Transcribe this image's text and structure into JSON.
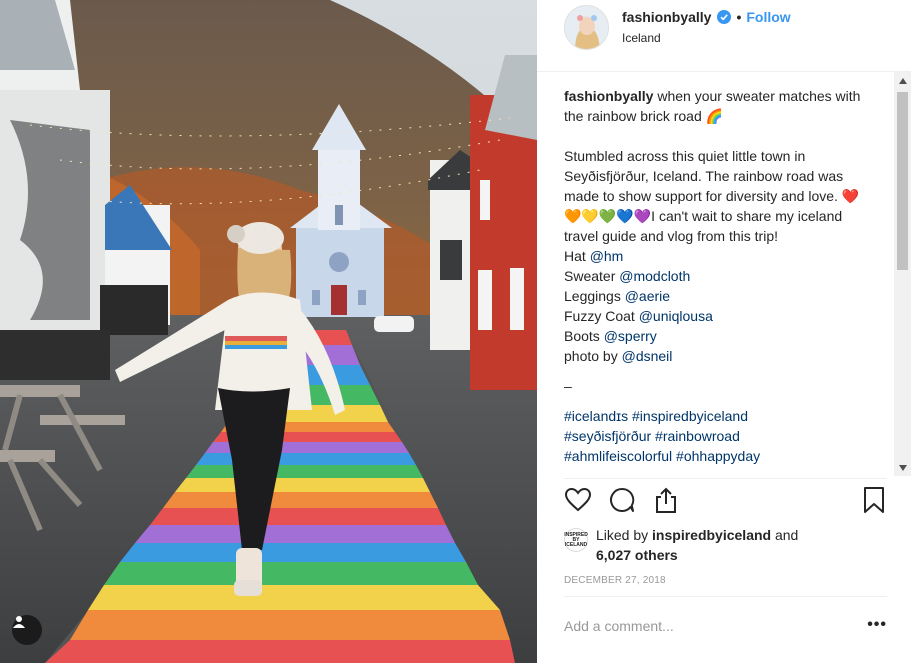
{
  "post": {
    "username": "fashionbyally",
    "follow_label": "Follow",
    "separator": "•",
    "location": "Iceland"
  },
  "caption": {
    "username": "fashionbyally",
    "line1": " when your sweater matches with the rainbow brick road 🌈",
    "para2": "Stumbled across this quiet little town in Seyðisfjörður, Iceland. The rainbow road was made to show support for diversity and love. ❤️🧡💛💚💙💜I can't wait to share my iceland travel guide and vlog from this trip!",
    "credits": [
      {
        "label": "Hat ",
        "handle": "@hm"
      },
      {
        "label": "Sweater ",
        "handle": "@modcloth"
      },
      {
        "label": "Leggings ",
        "handle": "@aerie"
      },
      {
        "label": "Fuzzy Coat ",
        "handle": "@uniqlousa"
      },
      {
        "label": "Boots ",
        "handle": "@sperry"
      },
      {
        "label": "photo by ",
        "handle": "@dsneil"
      }
    ],
    "dash": "–",
    "hashtags": [
      "#icelandɪs #inspiredbyiceland",
      "#seyðisfjörður #rainbowroad",
      "#ahmlifeiscolorful #ohhappyday"
    ]
  },
  "actions": {
    "like_icon": "heart-icon",
    "comment_icon": "comment-icon",
    "share_icon": "share-icon",
    "save_icon": "bookmark-icon"
  },
  "likes": {
    "badge_text": "INSPIRED BY ICELAND",
    "prefix": "Liked by ",
    "user": "inspiredbyiceland",
    "mid": " and",
    "count": "6,027 others"
  },
  "date": "December 27, 2018",
  "comment": {
    "placeholder": "Add a comment...",
    "more_label": "•••"
  },
  "colors": {
    "accent": "#3897f0",
    "link": "#003569",
    "muted": "#999999",
    "border": "#efefef"
  }
}
